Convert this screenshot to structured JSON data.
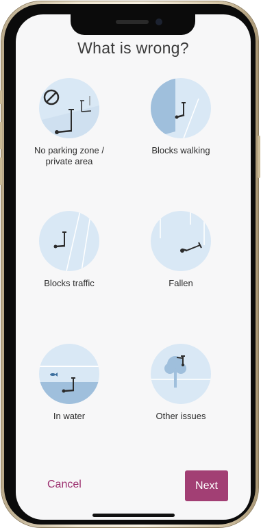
{
  "screen": {
    "title": "What is wrong?"
  },
  "options": [
    {
      "label": "No parking zone /\nprivate area",
      "icon": "no-parking-icon"
    },
    {
      "label": "Blocks walking",
      "icon": "blocks-walking-icon"
    },
    {
      "label": "Blocks traffic",
      "icon": "blocks-traffic-icon"
    },
    {
      "label": "Fallen",
      "icon": "fallen-scooter-icon"
    },
    {
      "label": "In water",
      "icon": "scooter-in-water-icon"
    },
    {
      "label": "Other issues",
      "icon": "other-issues-icon"
    }
  ],
  "footer": {
    "cancel_label": "Cancel",
    "next_label": "Next"
  },
  "colors": {
    "accent": "#a23f74",
    "cancel_text": "#9c2f6f",
    "circle_bg": "#d9e8f5",
    "circle_dark": "#9fbfdc"
  }
}
